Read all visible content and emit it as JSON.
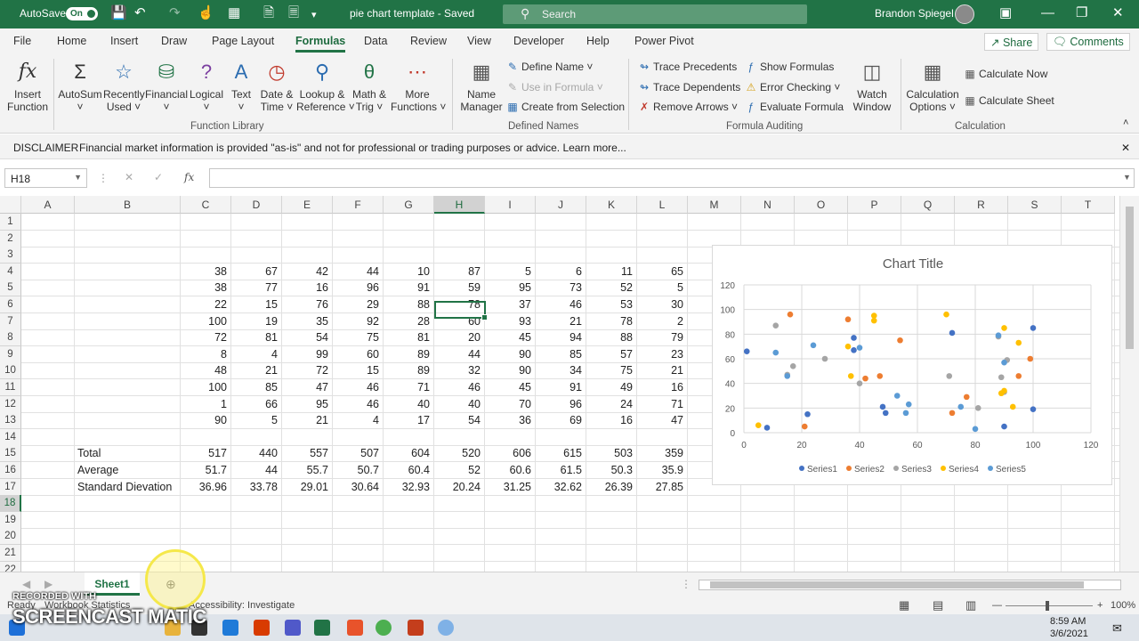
{
  "titlebar": {
    "autosave": "AutoSave",
    "autosave_state": "On",
    "doc_title": "pie chart template  -  Saved",
    "search_placeholder": "Search",
    "user": "Brandon Spiegel"
  },
  "tabs": [
    "File",
    "Home",
    "Insert",
    "Draw",
    "Page Layout",
    "Formulas",
    "Data",
    "Review",
    "View",
    "Developer",
    "Help",
    "Power Pivot"
  ],
  "share": "Share",
  "comments": "Comments",
  "ribbon": {
    "insert_function": [
      "Insert",
      "Function"
    ],
    "autosum": "AutoSum",
    "recently_used": [
      "Recently",
      "Used"
    ],
    "financial": "Financial",
    "logical": "Logical",
    "text": "Text",
    "date_time": [
      "Date &",
      "Time"
    ],
    "lookup": [
      "Lookup &",
      "Reference"
    ],
    "math": [
      "Math &",
      "Trig"
    ],
    "more": [
      "More",
      "Functions"
    ],
    "function_library": "Function Library",
    "name_manager": [
      "Name",
      "Manager"
    ],
    "define_name": "Define Name",
    "use_in_formula": "Use in Formula",
    "create_from_selection": "Create from Selection",
    "defined_names": "Defined Names",
    "trace_precedents": "Trace Precedents",
    "trace_dependents": "Trace Dependents",
    "remove_arrows": "Remove Arrows",
    "show_formulas": "Show Formulas",
    "error_checking": "Error Checking",
    "evaluate_formula": "Evaluate Formula",
    "watch_window": [
      "Watch",
      "Window"
    ],
    "formula_auditing": "Formula Auditing",
    "calc_options": [
      "Calculation",
      "Options"
    ],
    "calc_now": "Calculate Now",
    "calc_sheet": "Calculate Sheet",
    "calculation": "Calculation"
  },
  "disclaimer": {
    "label": "DISCLAIMER",
    "text": "Financial market information is provided \"as-is\" and not for professional or trading purposes or advice. Learn more..."
  },
  "formula_bar": {
    "name_box": "H18",
    "fx": "fx"
  },
  "columns": [
    "A",
    "B",
    "C",
    "D",
    "E",
    "F",
    "G",
    "H",
    "I",
    "J",
    "K",
    "L",
    "M",
    "N",
    "O",
    "P",
    "Q",
    "R",
    "S",
    "T"
  ],
  "rows": [
    "1",
    "2",
    "3",
    "4",
    "5",
    "6",
    "7",
    "8",
    "9",
    "10",
    "11",
    "12",
    "13",
    "14",
    "15",
    "16",
    "17",
    "18",
    "19",
    "20",
    "21",
    "22"
  ],
  "data_rows": [
    [
      "38",
      "67",
      "42",
      "44",
      "10",
      "87",
      "5",
      "6",
      "11",
      "65"
    ],
    [
      "38",
      "77",
      "16",
      "96",
      "91",
      "59",
      "95",
      "73",
      "52",
      "5"
    ],
    [
      "22",
      "15",
      "76",
      "29",
      "88",
      "78",
      "37",
      "46",
      "53",
      "30"
    ],
    [
      "100",
      "19",
      "35",
      "92",
      "28",
      "60",
      "93",
      "21",
      "78",
      "2"
    ],
    [
      "72",
      "81",
      "54",
      "75",
      "81",
      "20",
      "45",
      "94",
      "88",
      "79"
    ],
    [
      "8",
      "4",
      "99",
      "60",
      "89",
      "44",
      "90",
      "85",
      "57",
      "23"
    ],
    [
      "48",
      "21",
      "72",
      "15",
      "89",
      "32",
      "90",
      "34",
      "75",
      "21"
    ],
    [
      "100",
      "85",
      "47",
      "46",
      "71",
      "46",
      "45",
      "91",
      "49",
      "16"
    ],
    [
      "1",
      "66",
      "95",
      "46",
      "40",
      "40",
      "70",
      "96",
      "24",
      "71"
    ],
    [
      "90",
      "5",
      "21",
      "4",
      "17",
      "54",
      "36",
      "69",
      "16",
      "47"
    ]
  ],
  "summary": [
    {
      "label": "Total",
      "values": [
        "517",
        "440",
        "557",
        "507",
        "604",
        "520",
        "606",
        "615",
        "503",
        "359"
      ]
    },
    {
      "label": "Average",
      "values": [
        "51.7",
        "44",
        "55.7",
        "50.7",
        "60.4",
        "52",
        "60.6",
        "61.5",
        "50.3",
        "35.9"
      ]
    },
    {
      "label": "Standard Dievation",
      "values": [
        "36.96",
        "33.78",
        "29.01",
        "30.64",
        "32.93",
        "20.24",
        "31.25",
        "32.62",
        "26.39",
        "27.85"
      ]
    }
  ],
  "chart_data": {
    "type": "scatter",
    "title": "Chart Title",
    "xlim": [
      0,
      120
    ],
    "ylim": [
      0,
      120
    ],
    "xticks": [
      "0",
      "20",
      "40",
      "60",
      "80",
      "100",
      "120"
    ],
    "yticks": [
      "0",
      "20",
      "40",
      "60",
      "80",
      "100",
      "120"
    ],
    "grid": true,
    "legend": "bottom",
    "series": [
      {
        "name": "Series1",
        "color": "#4472C4",
        "points": [
          [
            1,
            66
          ],
          [
            8,
            4
          ],
          [
            22,
            15
          ],
          [
            38,
            77
          ],
          [
            38,
            67
          ],
          [
            48,
            21
          ],
          [
            49,
            16
          ],
          [
            72,
            81
          ],
          [
            90,
            5
          ],
          [
            100,
            85
          ],
          [
            100,
            19
          ]
        ]
      },
      {
        "name": "Series2",
        "color": "#ED7D31",
        "points": [
          [
            16,
            96
          ],
          [
            21,
            5
          ],
          [
            36,
            92
          ],
          [
            42,
            44
          ],
          [
            47,
            46
          ],
          [
            54,
            75
          ],
          [
            72,
            16
          ],
          [
            77,
            29
          ],
          [
            95,
            46
          ],
          [
            99,
            60
          ]
        ]
      },
      {
        "name": "Series3",
        "color": "#A5A5A5",
        "points": [
          [
            11,
            87
          ],
          [
            15,
            47
          ],
          [
            17,
            54
          ],
          [
            28,
            60
          ],
          [
            40,
            40
          ],
          [
            71,
            46
          ],
          [
            81,
            20
          ],
          [
            88,
            78
          ],
          [
            89,
            45
          ],
          [
            91,
            59
          ],
          [
            90,
            33
          ]
        ]
      },
      {
        "name": "Series4",
        "color": "#FFC000",
        "points": [
          [
            5,
            6
          ],
          [
            36,
            70
          ],
          [
            37,
            46
          ],
          [
            45,
            95
          ],
          [
            45,
            91
          ],
          [
            70,
            96
          ],
          [
            89,
            32
          ],
          [
            90,
            85
          ],
          [
            93,
            21
          ],
          [
            95,
            73
          ],
          [
            90,
            34
          ]
        ]
      },
      {
        "name": "Series5",
        "color": "#5B9BD5",
        "points": [
          [
            11,
            65
          ],
          [
            15,
            46
          ],
          [
            24,
            71
          ],
          [
            40,
            69
          ],
          [
            53,
            30
          ],
          [
            56,
            16
          ],
          [
            57,
            23
          ],
          [
            75,
            21
          ],
          [
            88,
            79
          ],
          [
            90,
            57
          ],
          [
            80,
            3
          ]
        ]
      }
    ]
  },
  "sheet_tab": "Sheet1",
  "status": {
    "ready": "Ready",
    "workbook_stats": "Workbook Statistics",
    "accessibility": "Accessibility: Investigate",
    "zoom": "100%"
  },
  "taskbar": {
    "time": "8:59 AM",
    "date": "3/6/2021"
  },
  "watermark": {
    "line1": "RECORDED WITH",
    "line2": "SCREENCAST  MATIC"
  }
}
